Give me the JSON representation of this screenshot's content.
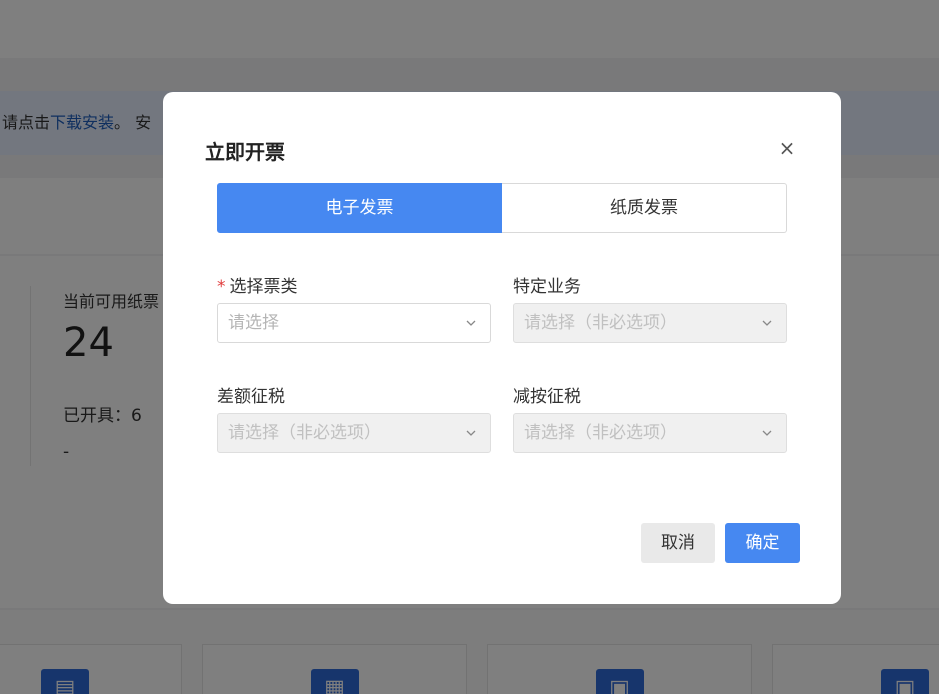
{
  "background": {
    "notice": {
      "prefix": "请点击",
      "link": "下载安装",
      "suffix": "。 安"
    },
    "stats": {
      "available_label": "当前可用纸票",
      "available_value": "24",
      "issued_label": "已开具：",
      "issued_value": "6",
      "dash": "-"
    }
  },
  "modal": {
    "title": "立即开票",
    "close_symbol": "×",
    "tabs": [
      {
        "label": "电子发票",
        "active": true
      },
      {
        "label": "纸质发票",
        "active": false
      }
    ],
    "fields": {
      "ticket_type": {
        "label": "选择票类",
        "required_mark": "*",
        "placeholder": "请选择"
      },
      "special_business": {
        "label": "特定业务",
        "placeholder": "请选择（非必选项）"
      },
      "diff_tax": {
        "label": "差额征税",
        "placeholder": "请选择（非必选项）"
      },
      "reduced_tax": {
        "label": "减按征税",
        "placeholder": "请选择（非必选项）"
      }
    },
    "buttons": {
      "cancel": "取消",
      "confirm": "确定"
    }
  },
  "colors": {
    "primary": "#4688f1",
    "required": "#e03c3c",
    "overlay": "rgba(0,0,0,0.5)"
  }
}
